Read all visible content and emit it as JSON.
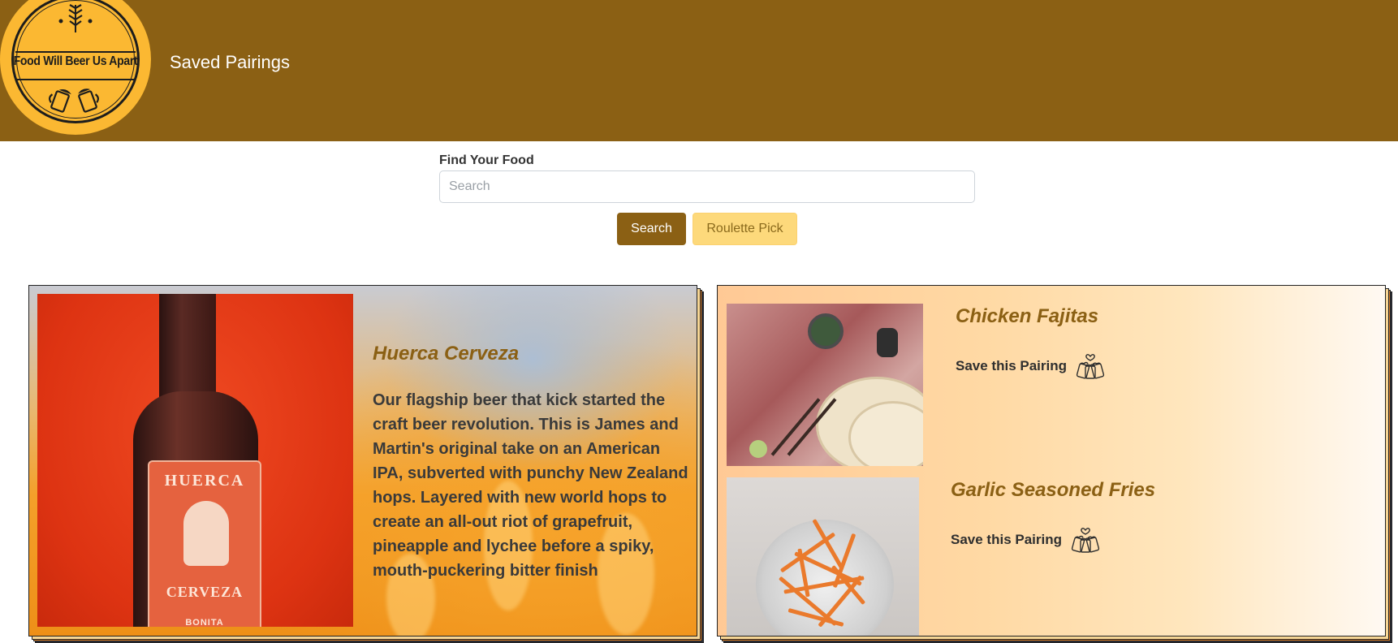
{
  "header": {
    "logo_text": "Food Will Beer Us Apart",
    "title": "Saved Pairings",
    "background_color": "#8b6014",
    "logo_color": "#fbb832"
  },
  "search": {
    "label": "Find Your Food",
    "placeholder": "Search",
    "value": "",
    "search_button": "Search",
    "roulette_button": "Roulette Pick"
  },
  "beer": {
    "name": "Huerca Cerveza",
    "description": "Our flagship beer that kick started the craft beer revolution. This is James and Martin's original take on an American IPA, subverted with punchy New Zealand hops. Layered with new world hops to create an all-out riot of grapefruit, pineapple and lychee before a spiky, mouth-puckering bitter finish",
    "label_brand": "HUERCA",
    "label_sub": "CERVEZA",
    "label_bottom": "BONITA"
  },
  "foods": [
    {
      "name": "Chicken Fajitas",
      "save_label": "Save this Pairing",
      "icon": "cheers-mugs-icon"
    },
    {
      "name": "Garlic Seasoned Fries",
      "save_label": "Save this Pairing",
      "icon": "cheers-mugs-icon"
    }
  ],
  "colors": {
    "brand_brown": "#8b6014",
    "roulette_yellow": "#fdd97b"
  }
}
